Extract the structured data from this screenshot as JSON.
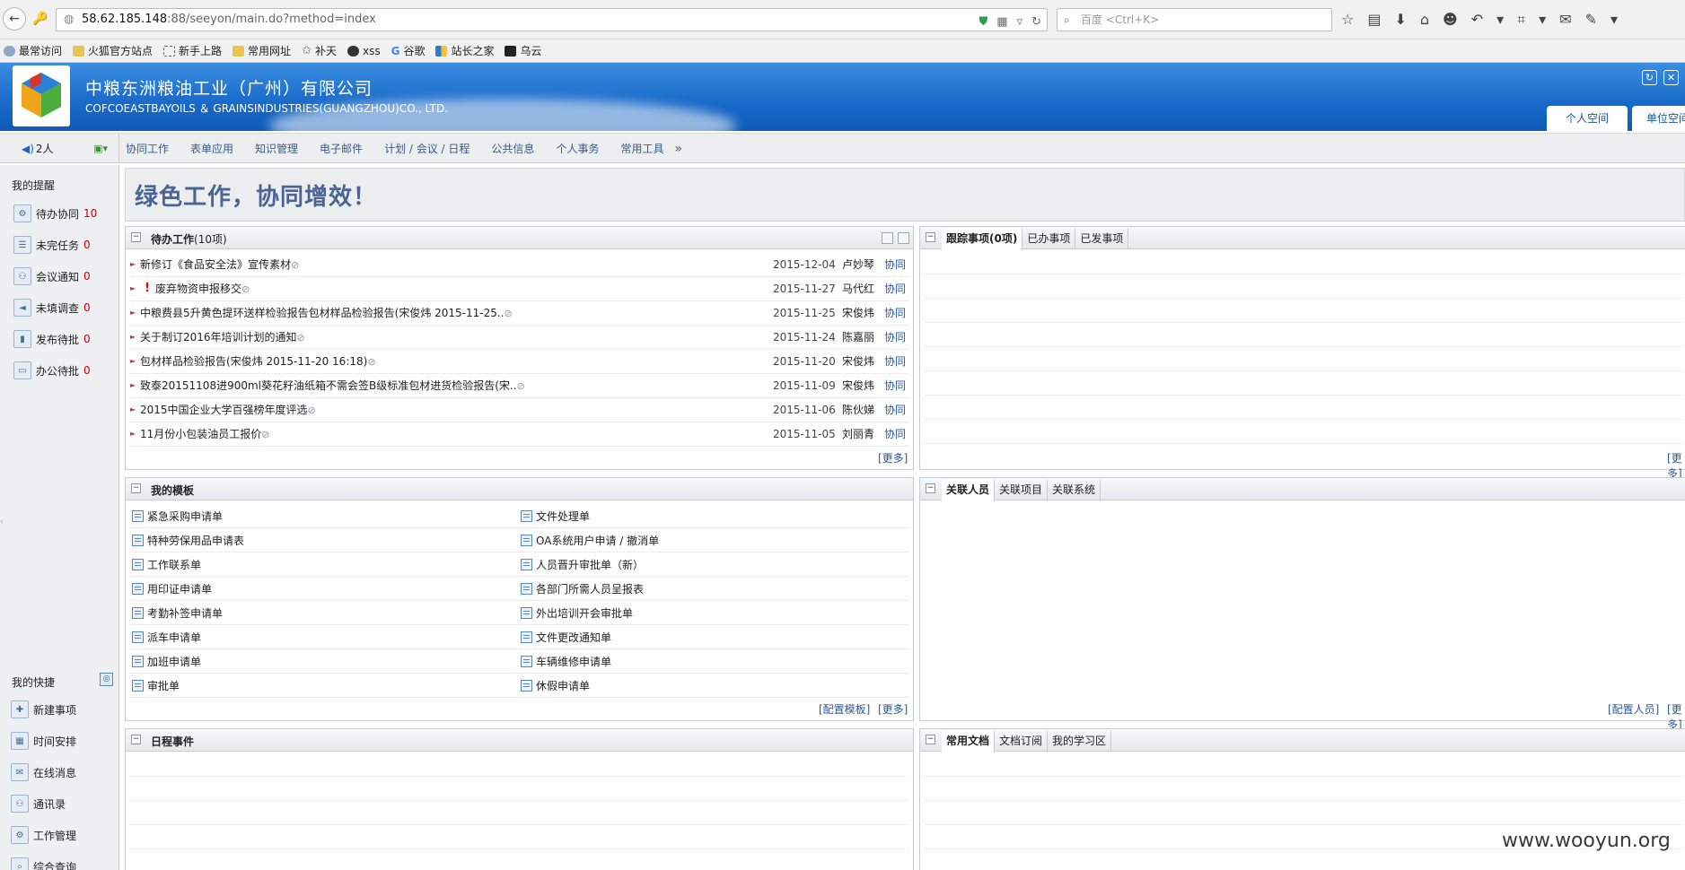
{
  "browser": {
    "url_host": "58.62.185.148",
    "url_path": ":88/seeyon/main.do?method=index",
    "search_placeholder": "百度 <Ctrl+K>"
  },
  "bookmarks": [
    {
      "label": "最常访问",
      "icon": "gear-icon"
    },
    {
      "label": "火狐官方站点",
      "icon": "folder-icon"
    },
    {
      "label": "新手上路",
      "icon": "dashed-square-icon"
    },
    {
      "label": "常用网址",
      "icon": "folder-icon"
    },
    {
      "label": "补天",
      "icon": "star-icon"
    },
    {
      "label": "xss",
      "icon": "round-logo-icon"
    },
    {
      "label": "谷歌",
      "icon": "google-icon"
    },
    {
      "label": "站长之家",
      "icon": "chart-logo-icon"
    },
    {
      "label": "乌云",
      "icon": "wooyun-icon"
    }
  ],
  "header": {
    "company_cn": "中粮东洲粮油工业（广州）有限公司",
    "company_en": "COFCOEASTBAYOILS ＆ GRAINSINDUSTRIES(GUANGZHOU)CO., LTD.",
    "space_tabs": [
      "个人空间",
      "单位空间"
    ]
  },
  "nav": {
    "online": "2人",
    "menu": [
      "协同工作",
      "表单应用",
      "知识管理",
      "电子邮件",
      "计划 / 会议 / 日程",
      "公共信息",
      "个人事务",
      "常用工具"
    ],
    "more": "»"
  },
  "left": {
    "reminder_title": "我的提醒",
    "reminders": [
      {
        "label": "待办协同",
        "count": "10"
      },
      {
        "label": "未完任务",
        "count": "0"
      },
      {
        "label": "会议通知",
        "count": "0"
      },
      {
        "label": "未填调查",
        "count": "0"
      },
      {
        "label": "发布待批",
        "count": "0"
      },
      {
        "label": "办公待批",
        "count": "0"
      }
    ],
    "quick_title": "我的快捷",
    "quick": [
      "新建事项",
      "时间安排",
      "在线消息",
      "通讯录",
      "工作管理",
      "综合查询"
    ]
  },
  "banner": "绿色工作，协同增效！",
  "todo": {
    "title": "待办工作",
    "count": "(10项)",
    "rows": [
      {
        "subject": "新修订《食品安全法》宣传素材",
        "important": false,
        "date": "2015-12-04",
        "person": "卢妙琴",
        "type": "协同"
      },
      {
        "subject": "废弃物资申报移交",
        "important": true,
        "date": "2015-11-27",
        "person": "马代红",
        "type": "协同"
      },
      {
        "subject": "中粮费县5升黄色提环送样检验报告包材样品检验报告(宋俊炜 2015-11-25..",
        "important": false,
        "date": "2015-11-25",
        "person": "宋俊炜",
        "type": "协同"
      },
      {
        "subject": "关于制订2016年培训计划的通知",
        "important": false,
        "date": "2015-11-24",
        "person": "陈嘉丽",
        "type": "协同"
      },
      {
        "subject": "包材样品检验报告(宋俊炜 2015-11-20 16:18)",
        "important": false,
        "date": "2015-11-20",
        "person": "宋俊炜",
        "type": "协同"
      },
      {
        "subject": "致泰20151108进900ml葵花籽油纸箱不需会签B级标准包材进货检验报告(宋..",
        "important": false,
        "date": "2015-11-09",
        "person": "宋俊炜",
        "type": "协同"
      },
      {
        "subject": "2015中国企业大学百强榜年度评选",
        "important": false,
        "date": "2015-11-06",
        "person": "陈伙娣",
        "type": "协同"
      },
      {
        "subject": "11月份小包装油员工报价",
        "important": false,
        "date": "2015-11-05",
        "person": "刘丽青",
        "type": "协同"
      }
    ],
    "more": "[更多]"
  },
  "tracking": {
    "tabs": [
      "跟踪事项(0项)",
      "已办事项",
      "已发事项"
    ],
    "more": "[更多]"
  },
  "templates": {
    "title": "我的模板",
    "col1": [
      "紧急采购申请单",
      "特种劳保用品申请表",
      "工作联系单",
      "用印证申请单",
      "考勤补签申请单",
      "派车申请单",
      "加班申请单",
      "审批单"
    ],
    "col2": [
      "文件处理单",
      "OA系统用户申请 / 撤消单",
      "人员晋升审批单（新）",
      "各部门所需人员呈报表",
      "外出培训开会审批单",
      "文件更改通知单",
      "车辆维修申请单",
      "休假申请单"
    ],
    "config": "[配置模板]",
    "more": "[更多]"
  },
  "related": {
    "tabs": [
      "关联人员",
      "关联项目",
      "关联系统"
    ],
    "config": "[配置人员]",
    "more": "[更多]"
  },
  "schedule": {
    "title": "日程事件"
  },
  "docs": {
    "tabs": [
      "常用文档",
      "文档订阅",
      "我的学习区"
    ]
  },
  "watermark": "www.wooyun.org"
}
